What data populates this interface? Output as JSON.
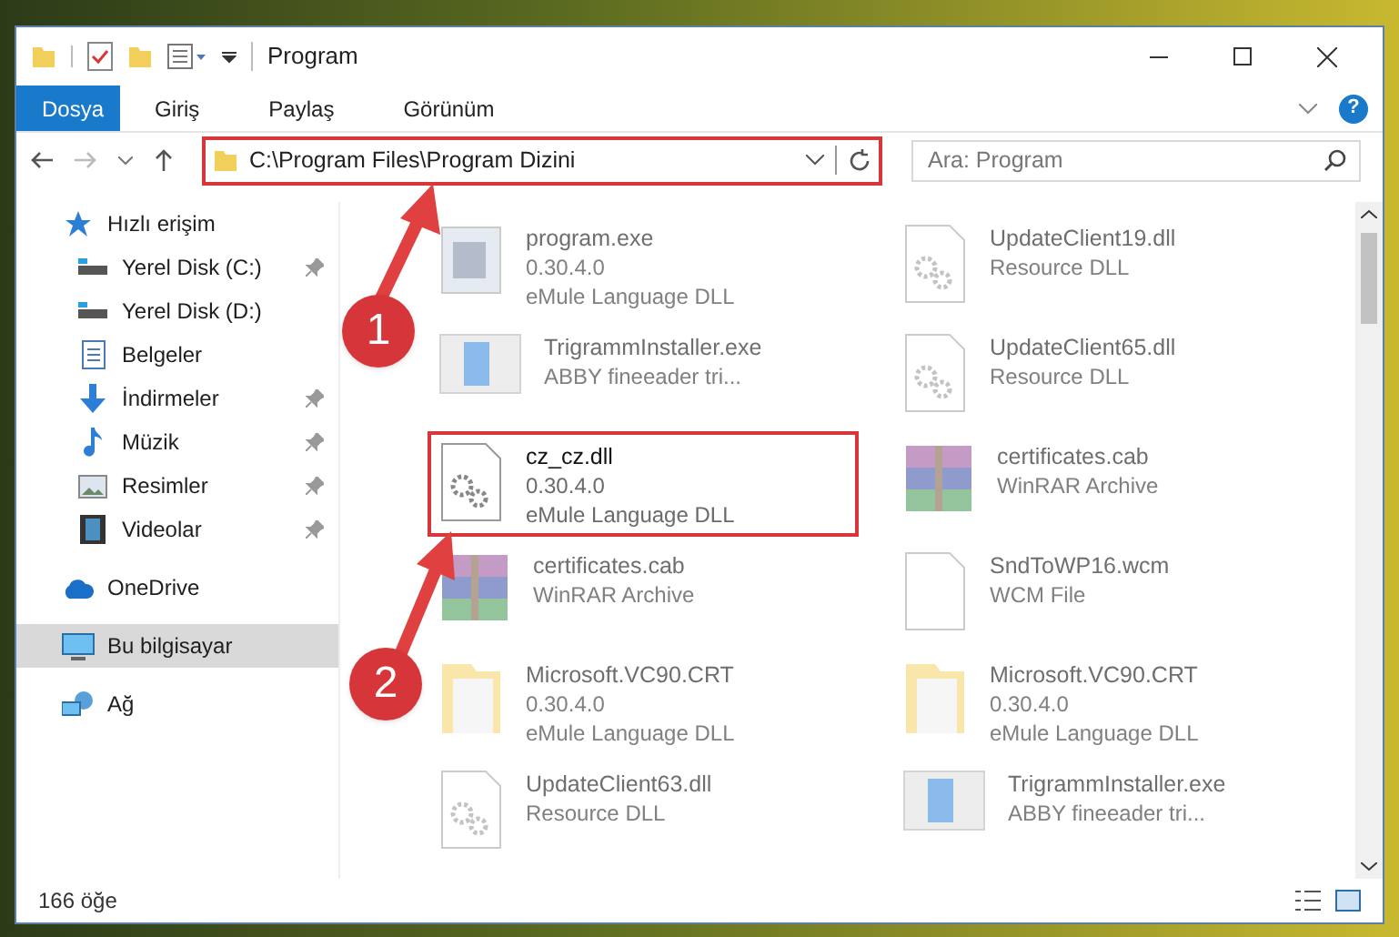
{
  "window": {
    "title": "Program"
  },
  "ribbon_tabs": [
    {
      "label": "Dosya",
      "selected": true
    },
    {
      "label": "Giriş",
      "selected": false
    },
    {
      "label": "Paylaş",
      "selected": false
    },
    {
      "label": "Görünüm",
      "selected": false
    }
  ],
  "address_bar": {
    "path": "C:\\Program Files\\Program Dizini"
  },
  "help_button": {
    "label": "?"
  },
  "search": {
    "placeholder": "Ara: Program"
  },
  "sidebar": {
    "items": [
      {
        "label": "Hızlı erişim",
        "pinned": false,
        "selected": false,
        "children": [
          {
            "label": "Yerel Disk (C:)",
            "pinned": true,
            "selected": false
          },
          {
            "label": "Yerel Disk (D:)",
            "pinned": false,
            "selected": false
          },
          {
            "label": "Belgeler",
            "pinned": false,
            "selected": false
          },
          {
            "label": "İndirmeler",
            "pinned": true,
            "selected": false
          },
          {
            "label": "Müzik",
            "pinned": true,
            "selected": false
          },
          {
            "label": "Resimler",
            "pinned": true,
            "selected": false
          },
          {
            "label": "Videolar",
            "pinned": true,
            "selected": false
          }
        ]
      },
      {
        "label": "OneDrive",
        "pinned": false,
        "selected": false
      },
      {
        "label": "Bu bilgisayar",
        "pinned": false,
        "selected": true
      },
      {
        "label": "Ağ",
        "pinned": false,
        "selected": false
      }
    ]
  },
  "files": [
    {
      "name": "program.exe",
      "kind": "app",
      "lines": [
        "0.30.4.0",
        "eMule Language DLL"
      ],
      "blurred": true,
      "highlighted": false
    },
    {
      "name": "UpdateClient19.dll",
      "kind": "dll",
      "lines": [
        "Resource DLL"
      ],
      "blurred": true,
      "highlighted": false
    },
    {
      "name": "TrigrammInstaller.exe",
      "kind": "installer",
      "lines": [
        "ABBY fineeader tri..."
      ],
      "blurred": true,
      "highlighted": false
    },
    {
      "name": "UpdateClient65.dll",
      "kind": "dll",
      "lines": [
        "Resource DLL"
      ],
      "blurred": true,
      "highlighted": false
    },
    {
      "name": "cz_cz.dll",
      "kind": "dll",
      "lines": [
        "0.30.4.0",
        "eMule Language DLL"
      ],
      "blurred": false,
      "highlighted": true
    },
    {
      "name": "certificates.cab",
      "kind": "archive",
      "lines": [
        "WinRAR Archive"
      ],
      "blurred": true,
      "highlighted": false
    },
    {
      "name": "certificates.cab",
      "kind": "archive",
      "lines": [
        "WinRAR Archive"
      ],
      "blurred": true,
      "highlighted": false
    },
    {
      "name": "SndToWP16.wcm",
      "kind": "blank",
      "lines": [
        "WCM File"
      ],
      "blurred": true,
      "highlighted": false
    },
    {
      "name": "Microsoft.VC90.CRT",
      "kind": "folder",
      "lines": [
        "0.30.4.0",
        "eMule Language DLL"
      ],
      "blurred": true,
      "highlighted": false
    },
    {
      "name": "Microsoft.VC90.CRT",
      "kind": "folder",
      "lines": [
        "0.30.4.0",
        "eMule Language DLL"
      ],
      "blurred": true,
      "highlighted": false
    },
    {
      "name": "UpdateClient63.dll",
      "kind": "dll",
      "lines": [
        "Resource DLL"
      ],
      "blurred": true,
      "highlighted": false
    },
    {
      "name": "TrigrammInstaller.exe",
      "kind": "installer",
      "lines": [
        "ABBY fineeader tri..."
      ],
      "blurred": true,
      "highlighted": false
    }
  ],
  "status_bar": {
    "item_count": "166 öğe"
  },
  "annotations": [
    {
      "number": "1"
    },
    {
      "number": "2"
    }
  ]
}
